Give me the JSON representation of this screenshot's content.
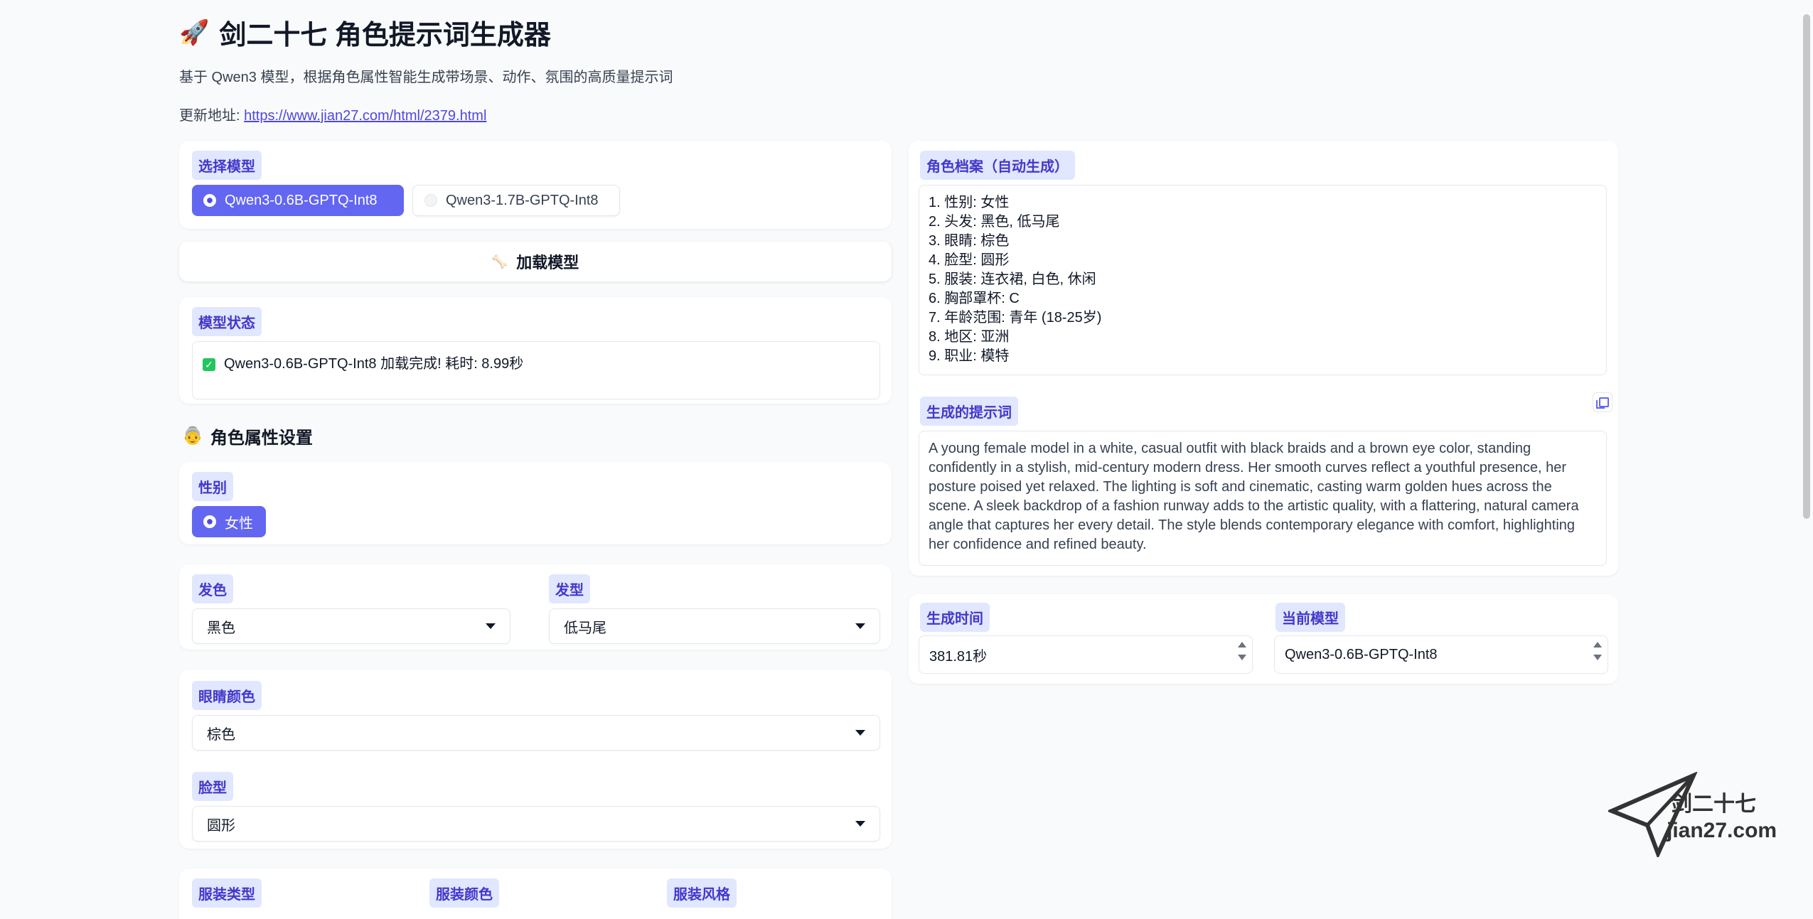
{
  "header": {
    "rocket_icon": "🚀",
    "title": "剑二十七 角色提示词生成器",
    "subtitle": "基于 Qwen3 模型，根据角色属性智能生成带场景、动作、氛围的高质量提示词",
    "link_prefix": "更新地址: ",
    "link_url": "https://www.jian27.com/html/2379.html"
  },
  "model_select": {
    "label": "选择模型",
    "options": [
      "Qwen3-0.6B-GPTQ-Int8",
      "Qwen3-1.7B-GPTQ-Int8"
    ],
    "selected_index": 0
  },
  "load_button": {
    "icon": "🦴",
    "label": "加载模型"
  },
  "model_status": {
    "label": "模型状态",
    "message": "Qwen3-0.6B-GPTQ-Int8 加载完成! 耗时: 8.99秒"
  },
  "attributes": {
    "section_icon": "👵",
    "section_title": "角色属性设置",
    "gender_label": "性别",
    "gender_value": "女性",
    "hair_color_label": "发色",
    "hair_color_value": "黑色",
    "hair_style_label": "发型",
    "hair_style_value": "低马尾",
    "eye_color_label": "眼睛颜色",
    "eye_color_value": "棕色",
    "face_label": "脸型",
    "face_value": "圆形",
    "outfit_type_label": "服装类型",
    "outfit_color_label": "服装颜色",
    "outfit_style_label": "服装风格"
  },
  "profile": {
    "label": "角色档案（自动生成）",
    "lines": [
      "1. 性别: 女性",
      "2. 头发: 黑色, 低马尾",
      "3. 眼睛: 棕色",
      "4. 脸型: 圆形",
      "5. 服装: 连衣裙, 白色, 休闲",
      "6. 胸部罩杯: C",
      "7. 年龄范围: 青年 (18-25岁)",
      "8. 地区: 亚洲",
      "9. 职业: 模特"
    ]
  },
  "prompt": {
    "label": "生成的提示词",
    "text": "A young female model in a white, casual outfit with black braids and a brown eye color, standing confidently in a stylish, mid-century modern dress. Her smooth curves reflect a youthful presence, her posture poised yet relaxed. The lighting is soft and cinematic, casting warm golden hues across the scene. A sleek backdrop of a fashion runway adds to the artistic quality, with a flattering, natural camera angle that captures her every detail. The style blends contemporary elegance with comfort, highlighting her confidence and refined beauty."
  },
  "gen_time": {
    "label": "生成时间",
    "value": "381.81秒"
  },
  "current_model": {
    "label": "当前模型",
    "value": "Qwen3-0.6B-GPTQ-Int8"
  },
  "logo": {
    "line1": "剑二十七",
    "line2": "jian27.com"
  },
  "colors": {
    "accent": "#6366f1",
    "chip_bg": "#e0e7ff",
    "chip_text": "#4338ca",
    "page_bg": "#f9fafb"
  }
}
